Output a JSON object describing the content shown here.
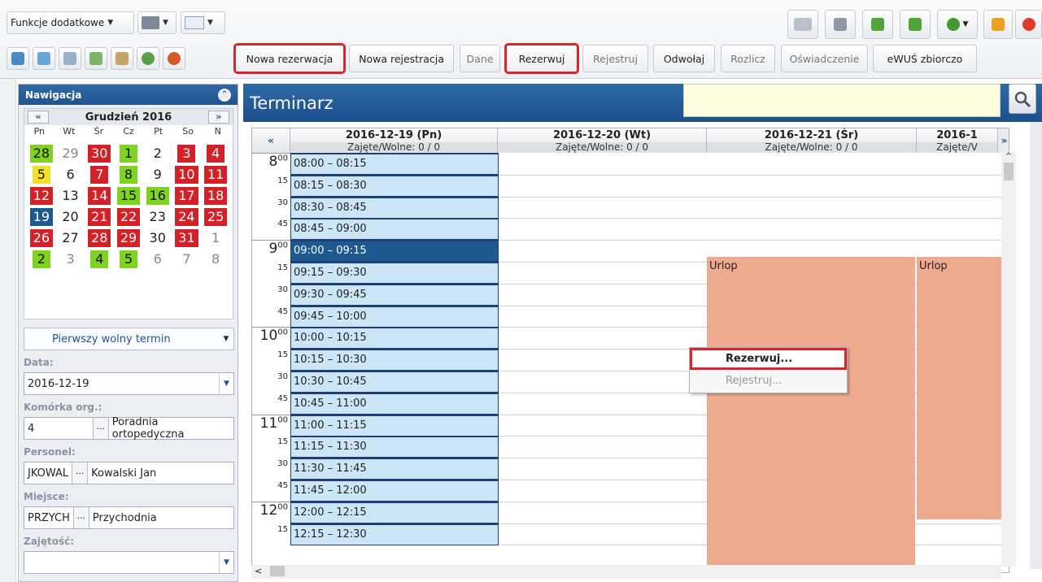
{
  "toolbar": {
    "dropdown_label": "Funkcje dodatkowe",
    "buttons": [
      "Nowa rezerwacja",
      "Nowa rejestracja",
      "Dane",
      "Rezerwuj",
      "Rejestruj",
      "Odwołaj",
      "Rozlicz",
      "Oświadczenie",
      "eWUŚ zbiorczo"
    ]
  },
  "nav": {
    "title": "Nawigacja",
    "month": "Grudzień 2016",
    "prev": "«",
    "next": "»",
    "dow": [
      "Pn",
      "Wt",
      "Śr",
      "Cz",
      "Pt",
      "So",
      "N"
    ],
    "days": [
      [
        "28",
        "gr"
      ],
      [
        "29",
        "m"
      ],
      [
        "30",
        "r"
      ],
      [
        "1",
        "gr"
      ],
      [
        "2",
        ""
      ],
      [
        "3",
        "r"
      ],
      [
        "4",
        "r"
      ],
      [
        "5",
        "y"
      ],
      [
        "6",
        ""
      ],
      [
        "7",
        "r"
      ],
      [
        "8",
        "gr"
      ],
      [
        "9",
        ""
      ],
      [
        "10",
        "r"
      ],
      [
        "11",
        "r"
      ],
      [
        "12",
        "r"
      ],
      [
        "13",
        ""
      ],
      [
        "14",
        "r"
      ],
      [
        "15",
        "gr"
      ],
      [
        "16",
        "gr"
      ],
      [
        "17",
        "r"
      ],
      [
        "18",
        "r"
      ],
      [
        "19",
        "b"
      ],
      [
        "20",
        ""
      ],
      [
        "21",
        "r"
      ],
      [
        "22",
        "r"
      ],
      [
        "23",
        ""
      ],
      [
        "24",
        "r"
      ],
      [
        "25",
        "r"
      ],
      [
        "26",
        "r"
      ],
      [
        "27",
        ""
      ],
      [
        "28",
        "r"
      ],
      [
        "29",
        "r"
      ],
      [
        "30",
        ""
      ],
      [
        "31",
        "r"
      ],
      [
        "1",
        "m"
      ],
      [
        "2",
        "gr"
      ],
      [
        "3",
        "m"
      ],
      [
        "4",
        "gr"
      ],
      [
        "5",
        "gr"
      ],
      [
        "6",
        "m"
      ],
      [
        "7",
        "m"
      ],
      [
        "8",
        "m"
      ]
    ],
    "first_free": "Pierwszy wolny termin",
    "data_label": "Data:",
    "data_value": "2016-12-19",
    "komorka_label": "Komórka org.:",
    "komorka_code": "4",
    "komorka_name": "Poradnia ortopedyczna",
    "personel_label": "Personel:",
    "personel_code": "JKOWAL",
    "personel_name": "Kowalski Jan",
    "miejsce_label": "Miejsce:",
    "miejsce_code": "PRZYCH",
    "miejsce_name": "Przychodnia",
    "zajetosc_label": "Zajętość:"
  },
  "main": {
    "title": "Terminarz",
    "columns": [
      {
        "date": "2016-12-19 (Pn)",
        "occ": "Zajęte/Wolne: 0 / 0"
      },
      {
        "date": "2016-12-20 (Wt)",
        "occ": "Zajęte/Wolne: 0 / 0"
      },
      {
        "date": "2016-12-21 (Śr)",
        "occ": "Zajęte/Wolne: 0 / 0"
      },
      {
        "date": "2016-1",
        "occ": "Zajęte/V"
      }
    ],
    "hours": [
      "8",
      "9",
      "10",
      "11",
      "12"
    ],
    "slots": [
      "08:00 – 08:15",
      "08:15 – 08:30",
      "08:30 – 08:45",
      "08:45 – 09:00",
      "09:00 – 09:15",
      "09:15 – 09:30",
      "09:30 – 09:45",
      "09:45 – 10:00",
      "10:00 – 10:15",
      "10:15 – 10:30",
      "10:30 – 10:45",
      "10:45 – 11:00",
      "11:00 – 11:15",
      "11:15 – 11:30",
      "11:30 – 11:45",
      "11:45 – 12:00",
      "12:00 – 12:15",
      "12:15 – 12:30"
    ],
    "urlop": "Urlop"
  },
  "context_menu": {
    "item1": "Rezerwuj...",
    "item2": "Rejestruj..."
  }
}
